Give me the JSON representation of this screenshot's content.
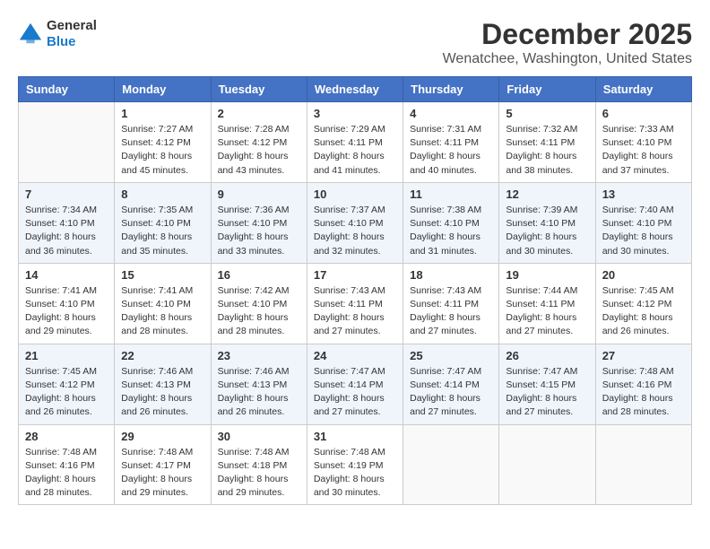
{
  "logo": {
    "general": "General",
    "blue": "Blue"
  },
  "title": "December 2025",
  "subtitle": "Wenatchee, Washington, United States",
  "days_of_week": [
    "Sunday",
    "Monday",
    "Tuesday",
    "Wednesday",
    "Thursday",
    "Friday",
    "Saturday"
  ],
  "weeks": [
    [
      {
        "day": "",
        "info": ""
      },
      {
        "day": "1",
        "info": "Sunrise: 7:27 AM\nSunset: 4:12 PM\nDaylight: 8 hours\nand 45 minutes."
      },
      {
        "day": "2",
        "info": "Sunrise: 7:28 AM\nSunset: 4:12 PM\nDaylight: 8 hours\nand 43 minutes."
      },
      {
        "day": "3",
        "info": "Sunrise: 7:29 AM\nSunset: 4:11 PM\nDaylight: 8 hours\nand 41 minutes."
      },
      {
        "day": "4",
        "info": "Sunrise: 7:31 AM\nSunset: 4:11 PM\nDaylight: 8 hours\nand 40 minutes."
      },
      {
        "day": "5",
        "info": "Sunrise: 7:32 AM\nSunset: 4:11 PM\nDaylight: 8 hours\nand 38 minutes."
      },
      {
        "day": "6",
        "info": "Sunrise: 7:33 AM\nSunset: 4:10 PM\nDaylight: 8 hours\nand 37 minutes."
      }
    ],
    [
      {
        "day": "7",
        "info": "Sunrise: 7:34 AM\nSunset: 4:10 PM\nDaylight: 8 hours\nand 36 minutes."
      },
      {
        "day": "8",
        "info": "Sunrise: 7:35 AM\nSunset: 4:10 PM\nDaylight: 8 hours\nand 35 minutes."
      },
      {
        "day": "9",
        "info": "Sunrise: 7:36 AM\nSunset: 4:10 PM\nDaylight: 8 hours\nand 33 minutes."
      },
      {
        "day": "10",
        "info": "Sunrise: 7:37 AM\nSunset: 4:10 PM\nDaylight: 8 hours\nand 32 minutes."
      },
      {
        "day": "11",
        "info": "Sunrise: 7:38 AM\nSunset: 4:10 PM\nDaylight: 8 hours\nand 31 minutes."
      },
      {
        "day": "12",
        "info": "Sunrise: 7:39 AM\nSunset: 4:10 PM\nDaylight: 8 hours\nand 30 minutes."
      },
      {
        "day": "13",
        "info": "Sunrise: 7:40 AM\nSunset: 4:10 PM\nDaylight: 8 hours\nand 30 minutes."
      }
    ],
    [
      {
        "day": "14",
        "info": "Sunrise: 7:41 AM\nSunset: 4:10 PM\nDaylight: 8 hours\nand 29 minutes."
      },
      {
        "day": "15",
        "info": "Sunrise: 7:41 AM\nSunset: 4:10 PM\nDaylight: 8 hours\nand 28 minutes."
      },
      {
        "day": "16",
        "info": "Sunrise: 7:42 AM\nSunset: 4:10 PM\nDaylight: 8 hours\nand 28 minutes."
      },
      {
        "day": "17",
        "info": "Sunrise: 7:43 AM\nSunset: 4:11 PM\nDaylight: 8 hours\nand 27 minutes."
      },
      {
        "day": "18",
        "info": "Sunrise: 7:43 AM\nSunset: 4:11 PM\nDaylight: 8 hours\nand 27 minutes."
      },
      {
        "day": "19",
        "info": "Sunrise: 7:44 AM\nSunset: 4:11 PM\nDaylight: 8 hours\nand 27 minutes."
      },
      {
        "day": "20",
        "info": "Sunrise: 7:45 AM\nSunset: 4:12 PM\nDaylight: 8 hours\nand 26 minutes."
      }
    ],
    [
      {
        "day": "21",
        "info": "Sunrise: 7:45 AM\nSunset: 4:12 PM\nDaylight: 8 hours\nand 26 minutes."
      },
      {
        "day": "22",
        "info": "Sunrise: 7:46 AM\nSunset: 4:13 PM\nDaylight: 8 hours\nand 26 minutes."
      },
      {
        "day": "23",
        "info": "Sunrise: 7:46 AM\nSunset: 4:13 PM\nDaylight: 8 hours\nand 26 minutes."
      },
      {
        "day": "24",
        "info": "Sunrise: 7:47 AM\nSunset: 4:14 PM\nDaylight: 8 hours\nand 27 minutes."
      },
      {
        "day": "25",
        "info": "Sunrise: 7:47 AM\nSunset: 4:14 PM\nDaylight: 8 hours\nand 27 minutes."
      },
      {
        "day": "26",
        "info": "Sunrise: 7:47 AM\nSunset: 4:15 PM\nDaylight: 8 hours\nand 27 minutes."
      },
      {
        "day": "27",
        "info": "Sunrise: 7:48 AM\nSunset: 4:16 PM\nDaylight: 8 hours\nand 28 minutes."
      }
    ],
    [
      {
        "day": "28",
        "info": "Sunrise: 7:48 AM\nSunset: 4:16 PM\nDaylight: 8 hours\nand 28 minutes."
      },
      {
        "day": "29",
        "info": "Sunrise: 7:48 AM\nSunset: 4:17 PM\nDaylight: 8 hours\nand 29 minutes."
      },
      {
        "day": "30",
        "info": "Sunrise: 7:48 AM\nSunset: 4:18 PM\nDaylight: 8 hours\nand 29 minutes."
      },
      {
        "day": "31",
        "info": "Sunrise: 7:48 AM\nSunset: 4:19 PM\nDaylight: 8 hours\nand 30 minutes."
      },
      {
        "day": "",
        "info": ""
      },
      {
        "day": "",
        "info": ""
      },
      {
        "day": "",
        "info": ""
      }
    ]
  ]
}
